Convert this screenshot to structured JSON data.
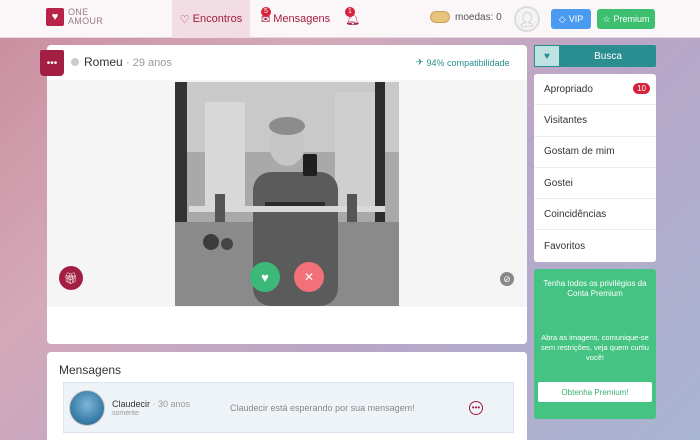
{
  "header": {
    "logo_line1": "ONE",
    "logo_line2": "AMOUR",
    "nav": [
      {
        "label": "Encontros",
        "badge": ""
      },
      {
        "label": "Mensagens",
        "badge": "5"
      },
      {
        "label": "",
        "badge": "1"
      }
    ],
    "coins_label": "moedas: 0",
    "vip_label": "VIP",
    "premium_label": "Premium"
  },
  "profile": {
    "name": "Romeu",
    "age": "· 29 anos",
    "compatibility": "94% compatibilidade"
  },
  "messages": {
    "title": "Mensagens",
    "items": [
      {
        "name": "Claudecir",
        "age": "· 30 anos",
        "status": "somente",
        "preview": "Claudecir está esperando por sua mensagem!"
      }
    ]
  },
  "sidebar": {
    "search_label": "Busca",
    "items": [
      {
        "label": "Apropriado",
        "badge": "10"
      },
      {
        "label": "Visitantes",
        "badge": ""
      },
      {
        "label": "Gostam de mim",
        "badge": ""
      },
      {
        "label": "Gostei",
        "badge": ""
      },
      {
        "label": "Coincidências",
        "badge": ""
      },
      {
        "label": "Favoritos",
        "badge": ""
      }
    ],
    "premium": {
      "title": "Tenha todos os privilégios da Conta Premium",
      "description": "Abra as imagens, comunique-se sem restrições, veja quem curtiu você!",
      "button_label": "Obtenha Premium!"
    }
  },
  "colors": {
    "brand": "#a31e43",
    "teal": "#2a8d90",
    "green": "#3cc06f",
    "vip_blue": "#4a9bef"
  }
}
